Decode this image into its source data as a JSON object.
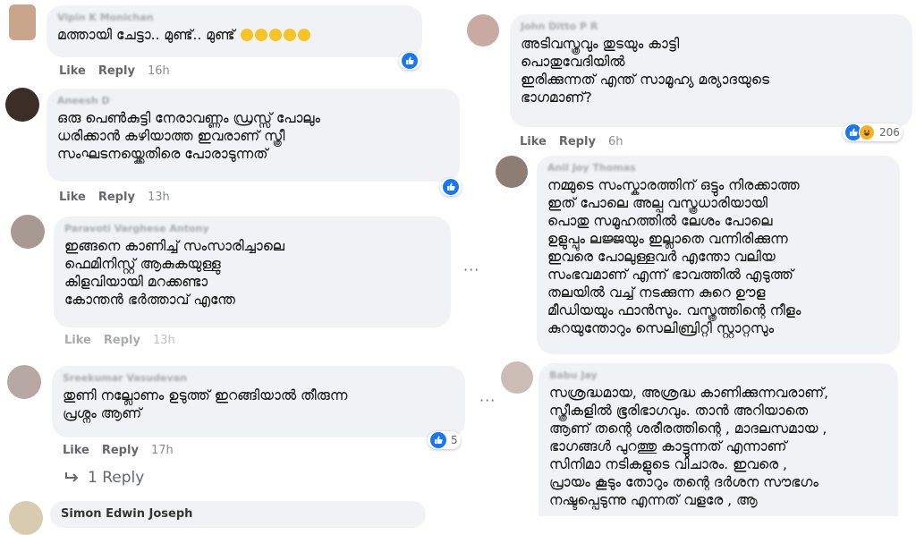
{
  "comments": [
    {
      "author": "Vipin K Monichan",
      "text": "മത്തായി ചേട്ടാ.. മുണ്ട്.. മുണ്ട്",
      "like": "Like",
      "reply": "Reply",
      "time": "16h"
    },
    {
      "author": "Aneesh D",
      "text": "ഒരു പെൺകുട്ടി നേരാവണ്ണം ഡ്രസ്സ് പോലും\nധരിക്കാൻ കഴിയാത്ത ഇവരാണ് സ്ത്രീ\nസംഘടനയ്ക്കെതിരെ പോരാടുന്നത്",
      "like": "Like",
      "reply": "Reply",
      "time": "13h"
    },
    {
      "author": "Paravoti Varghese Antony",
      "text": "ഇങ്ങനെ കാണിച്ച് സംസാരിച്ചാലെ\nഫെമിനിസ്റ്റ് ആകുകയുള്ളു\nകിളവിയായി മറക്കണ്ടാ\nകോന്തൻ ഭർത്താവ് എന്തേ",
      "like": "Like",
      "reply": "Reply",
      "time": "13h"
    },
    {
      "author": "Sreekumar Vasudevan",
      "text": "തുണി നല്ലോണം ഉടുത്ത് ഇറങ്ങിയാൽ തീരുന്ന\nപ്രശ്നം ആണ്",
      "like": "Like",
      "reply": "Reply",
      "time": "17h",
      "reactions": "5",
      "replies_label": "1 Reply"
    },
    {
      "author": "Simon Edwin Joseph"
    },
    {
      "author": "John Ditto P R",
      "text": "അടിവസ്ത്രവും തുടയും കാട്ടി\nപൊതുവേദിയിൽ\nഇരിക്കുന്നത് എന്ത് സാമൂഹ്യ മര്യാദയുടെ\nഭാഗമാണ്?",
      "like": "Like",
      "reply": "Reply",
      "time": "6h",
      "reactions": "206"
    },
    {
      "author": "Anil Joy Thomas",
      "text": "നമ്മുടെ സംസ്കാരത്തിന് ഒട്ടും നിരക്കാത്ത\nഇത് പോലെ അല്പ വസ്ത്രധാരിയായി\nപൊതു സമൂഹത്തിൽ ലേശം പോലെ\nഉളുപ്പും ലജ്ജയും ഇല്ലാതെ വന്നിരിക്കുന്ന\nഇവരെ പോലുള്ളവർ എന്തോ വലിയ\nസംഭവമാണ് എന്ന് ഭാവത്തിൽ എടുത്ത്\nതലയിൽ വച്ച് നടക്കുന്ന കുറെ ഊള\nമീഡിയയും ഫാൻസും. വസ്ത്രത്തിന്റെ നീളം\nകുറയുന്തോറും സെലിബ്രിറ്റി സ്റ്റാറ്റസും"
    },
    {
      "author": "Babu Jay",
      "text": "സശ്രദ്ധമായ, അശ്രദ്ധ കാണിക്കുന്നവരാണ്,\nസ്ത്രീകളിൽ ഭൂരിഭാഗവും. താൻ അറിയാതെ\nആണ് തന്റെ ശരീരത്തിന്റെ , മാദലസമായ ,\nഭാഗങ്ങൾ പുറത്തു കാട്ടുന്നത് എന്നാണ്\nസിനിമാ നടികളുടെ വിചാരം. ഇവരെ ,\nപ്രായം കൂടും തോറും തന്റെ ദർശന സൗഭഗം\nനഷ്ടപ്പെടുന്നു എന്നത് വളരേ , ആ"
    }
  ],
  "icons": {
    "like": "thumbs-up-icon",
    "haha": "haha-icon",
    "more": "more-options-icon",
    "reply_arrow": "reply-arrow-icon"
  },
  "colors": {
    "bubble": "#f0f2f5",
    "like_blue": "#1877f2",
    "meta": "#65676b"
  }
}
